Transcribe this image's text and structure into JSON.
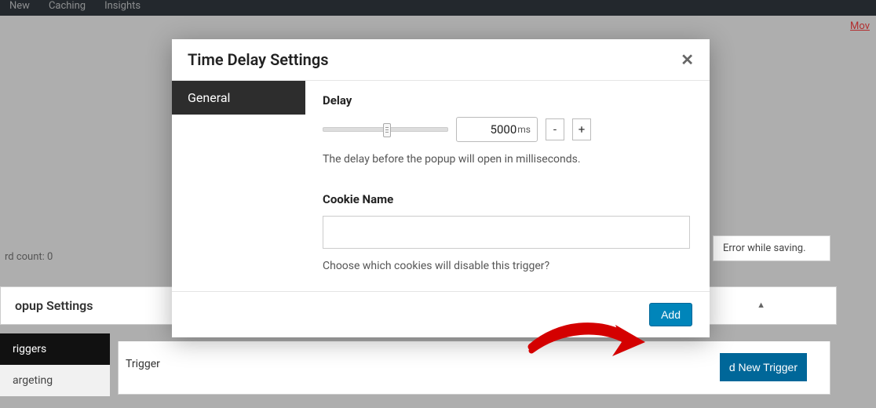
{
  "adminbar": {
    "items": [
      "New",
      "Caching",
      "Insights"
    ]
  },
  "page": {
    "move_link": "Mov",
    "word_count": "rd count: 0",
    "error_text": "Error while saving.",
    "panel_title": "opup Settings",
    "side_tabs": [
      "riggers",
      "argeting"
    ],
    "trigger_label": "Trigger",
    "new_trigger_btn": "d New Trigger"
  },
  "modal": {
    "title": "Time Delay Settings",
    "tab_general": "General",
    "delay": {
      "label": "Delay",
      "value": "5000",
      "unit": "ms",
      "dec": "-",
      "inc": "+",
      "help": "The delay before the popup will open in milliseconds."
    },
    "cookie": {
      "label": "Cookie Name",
      "help": "Choose which cookies will disable this trigger?"
    },
    "add_btn": "Add"
  }
}
